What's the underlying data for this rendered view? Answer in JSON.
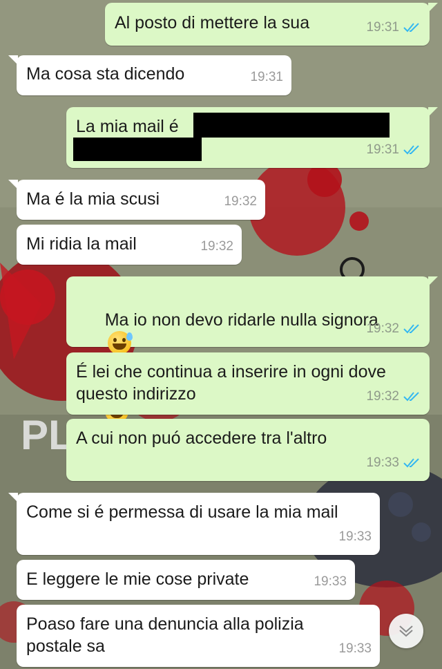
{
  "colors": {
    "outgoing_bubble": "#dcf8c6",
    "incoming_bubble": "#ffffff",
    "read_ticks": "#34b7f1"
  },
  "messages": [
    {
      "direction": "out",
      "text": "Al posto di mettere la sua",
      "time": "19:31",
      "status": "read"
    },
    {
      "direction": "in",
      "text": "Ma cosa sta dicendo",
      "time": "19:31"
    },
    {
      "direction": "out",
      "text": "La mia mail é",
      "time": "19:31",
      "status": "read",
      "redacted": true
    },
    {
      "direction": "in",
      "text": "Ma é la mia scusi",
      "time": "19:32"
    },
    {
      "direction": "in",
      "text": "Mi ridia la mail",
      "time": "19:32"
    },
    {
      "direction": "out",
      "text": "Ma io non devo ridarle nulla signora",
      "time": "19:32",
      "status": "read",
      "emoji": "grinning-face-with-sweat"
    },
    {
      "direction": "out",
      "text": "É lei che continua a inserire in ogni dove\nquesto indirizzo",
      "time": "19:32",
      "status": "read"
    },
    {
      "direction": "out",
      "text": "A cui non puó accedere tra l'altro",
      "time": "19:33",
      "status": "read"
    },
    {
      "direction": "in",
      "text": "Come si é permessa di usare la mia mail",
      "time": "19:33"
    },
    {
      "direction": "in",
      "text": "E leggere le mie cose private",
      "time": "19:33"
    },
    {
      "direction": "in",
      "text": "Poaso fare una denuncia alla polizia\npostale sa",
      "time": "19:33"
    }
  ],
  "scroll_button": {
    "icon": "chevrons-down-icon"
  }
}
